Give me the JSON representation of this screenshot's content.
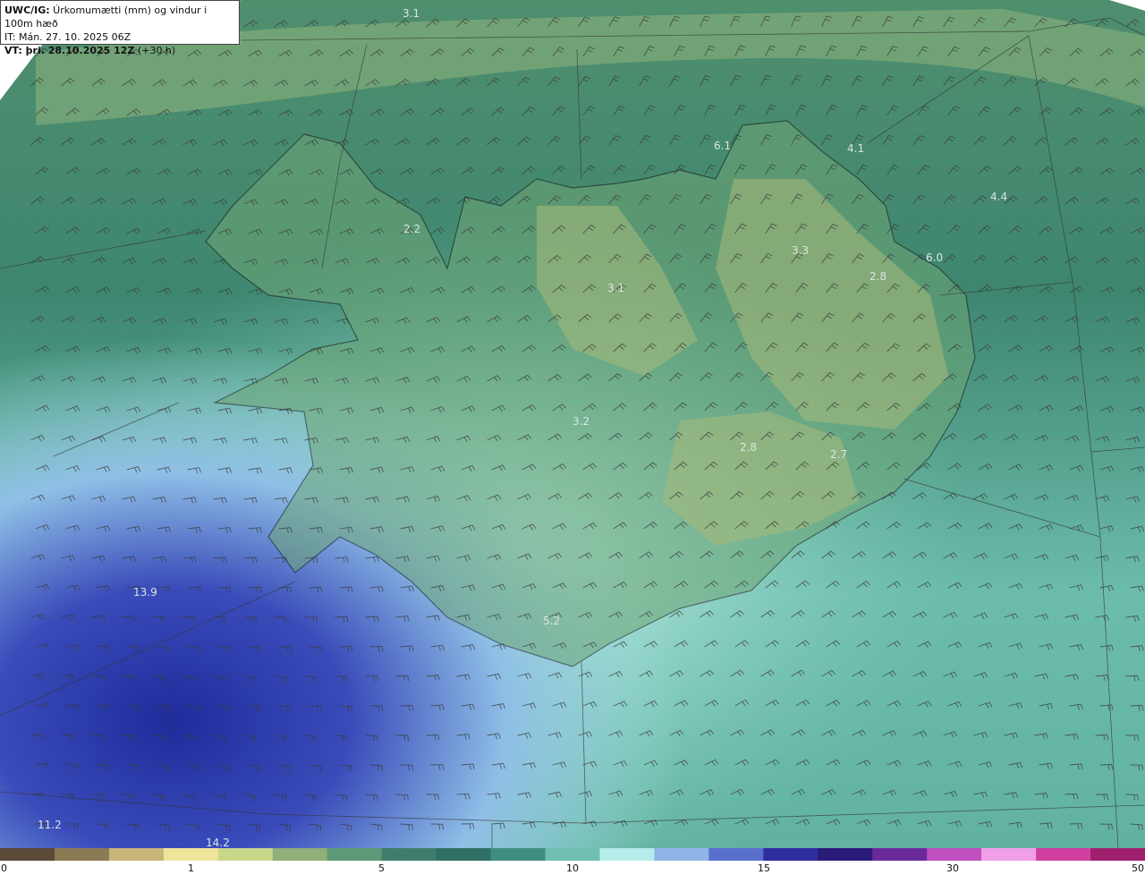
{
  "header": {
    "model": "UWC/IG:",
    "description": " Úrkomumætti (mm) og vindur i 100m hæð",
    "init_time": "IT: Mán. 27. 10. 2025 06Z",
    "valid_label": "VT: þri. 28.10.2025 12Z",
    "valid_offset": " (+30 h)"
  },
  "map_values": [
    "3.1",
    "6.1",
    "4.1",
    "4.4",
    "2.2",
    "3.3",
    "6.0",
    "2.8",
    "3.1",
    "3.2",
    "2.8",
    "2.7",
    "13.9",
    "5.2",
    "11.2",
    "14.2"
  ],
  "colorbar": {
    "ticks": [
      "0",
      "1",
      "5",
      "10",
      "15",
      "30",
      "50"
    ],
    "colors": [
      "#5a4a36",
      "#8c7a55",
      "#c8b57a",
      "#f0e49a",
      "#c9d78a",
      "#8fb07a",
      "#5f9a78",
      "#3f7d6c",
      "#2f6f64",
      "#3f8c80",
      "#6fc0b0",
      "#b6ecea",
      "#8fb4e6",
      "#5870cc",
      "#2e2ea0",
      "#2a1a7a",
      "#6a2a9a",
      "#c04fc0",
      "#f0a0e8",
      "#d040a0",
      "#a02070"
    ]
  }
}
